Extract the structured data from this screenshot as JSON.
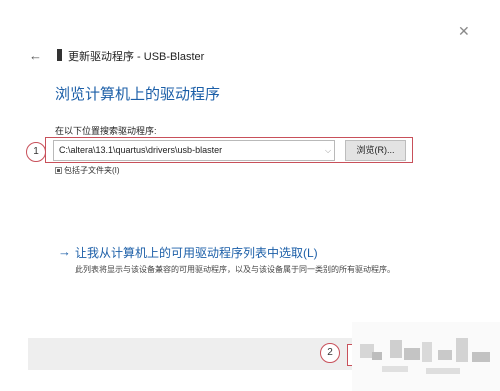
{
  "header": {
    "back_icon": "back-arrow-icon",
    "title": "更新驱动程序 - USB-Blaster",
    "close_icon": "close-icon"
  },
  "main": {
    "title": "浏览计算机上的驱动程序",
    "path_label": "在以下位置搜索驱动程序:",
    "path_value": "C:\\altera\\13.1\\quartus\\drivers\\usb-blaster",
    "browse_label": "浏览(R)...",
    "include_subfolders_label": "包括子文件夹(I)",
    "include_subfolders_checked": true,
    "pick_link": {
      "title": "让我从计算机上的可用驱动程序列表中选取(L)",
      "description": "此列表将显示与该设备兼容的可用驱动程序，以及与该设备属于同一类别的所有驱动程序。"
    }
  },
  "callouts": [
    "1",
    "2"
  ],
  "colors": {
    "accent": "#1c5fa8",
    "callout": "#c8505a"
  }
}
